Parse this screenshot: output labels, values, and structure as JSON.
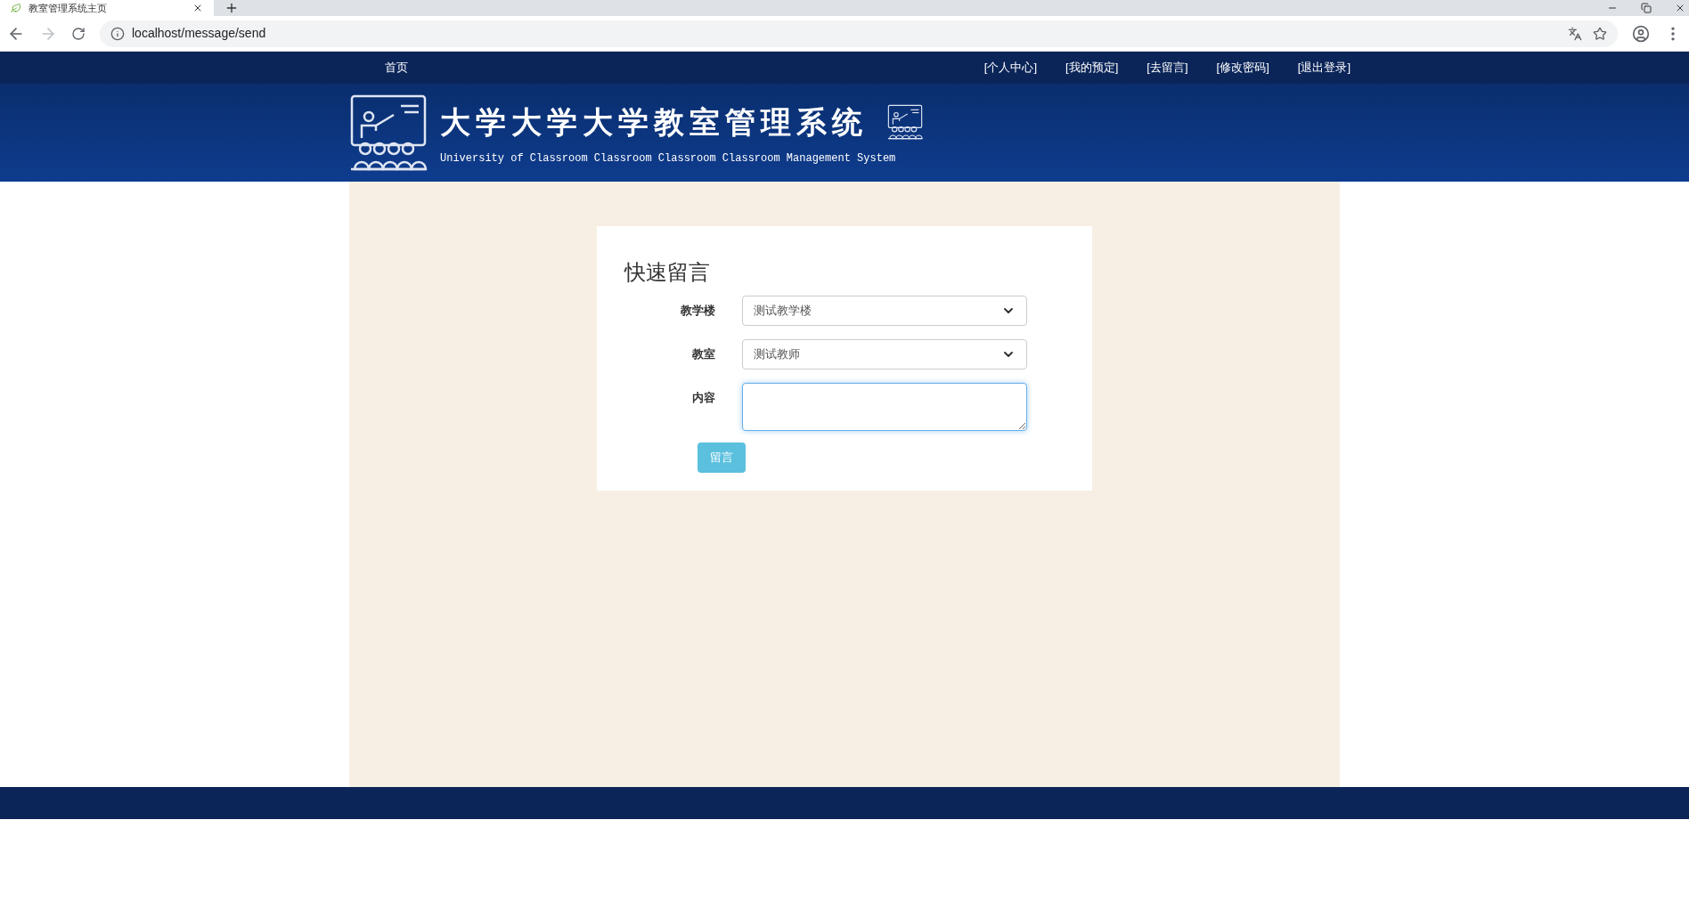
{
  "browser": {
    "tab_title": "教室管理系统主页",
    "url": "localhost/message/send"
  },
  "nav": {
    "home": "首页",
    "links": [
      "[个人中心]",
      "[我的预定]",
      "[去留言]",
      "[修改密码]",
      "[退出登录]"
    ]
  },
  "header": {
    "title": "大学大学大学教室管理系统",
    "subtitle": "University of Classroom Classroom Classroom Classroom Management System"
  },
  "form": {
    "heading": "快速留言",
    "fields": [
      {
        "kind": "select",
        "label": "教学楼",
        "value": "测试教学楼",
        "focused": false
      },
      {
        "kind": "select",
        "label": "教室",
        "value": "测试教师",
        "focused": false
      },
      {
        "kind": "textarea",
        "label": "内容",
        "focused": true
      }
    ],
    "submit": "留言"
  }
}
